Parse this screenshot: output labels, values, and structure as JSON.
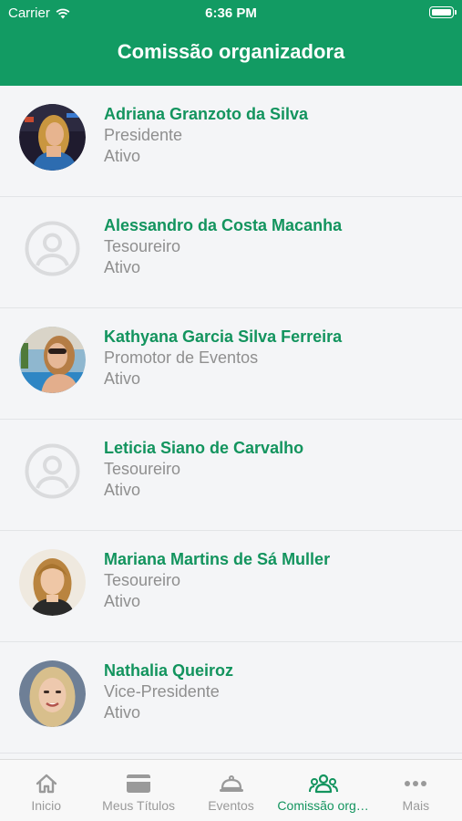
{
  "status_bar": {
    "carrier": "Carrier",
    "time": "6:36 PM"
  },
  "header": {
    "title": "Comissão organizadora"
  },
  "members": [
    {
      "name": "Adriana Granzoto da Silva",
      "role": "Presidente",
      "status": "Ativo",
      "avatar": "photo"
    },
    {
      "name": "Alessandro da Costa Macanha",
      "role": "Tesoureiro",
      "status": "Ativo",
      "avatar": "placeholder"
    },
    {
      "name": "Kathyana Garcia Silva Ferreira",
      "role": "Promotor de Eventos",
      "status": "Ativo",
      "avatar": "photo"
    },
    {
      "name": "Leticia Siano de Carvalho",
      "role": "Tesoureiro",
      "status": "Ativo",
      "avatar": "placeholder"
    },
    {
      "name": "Mariana Martins de Sá Muller",
      "role": "Tesoureiro",
      "status": "Ativo",
      "avatar": "photo"
    },
    {
      "name": "Nathalia Queiroz",
      "role": "Vice-Presidente",
      "status": "Ativo",
      "avatar": "photo"
    }
  ],
  "tabbar": {
    "tabs": [
      {
        "label": "Inicio",
        "icon": "home-icon",
        "active": false
      },
      {
        "label": "Meus Títulos",
        "icon": "card-icon",
        "active": false
      },
      {
        "label": "Eventos",
        "icon": "cloche-icon",
        "active": false
      },
      {
        "label": "Comissão organizadora",
        "icon": "group-icon",
        "active": true
      },
      {
        "label": "Mais",
        "icon": "more-icon",
        "active": false
      }
    ]
  },
  "colors": {
    "primary": "#129b63",
    "accent_text": "#13945e",
    "muted_text": "#8f8f8f",
    "background": "#f4f5f7"
  }
}
